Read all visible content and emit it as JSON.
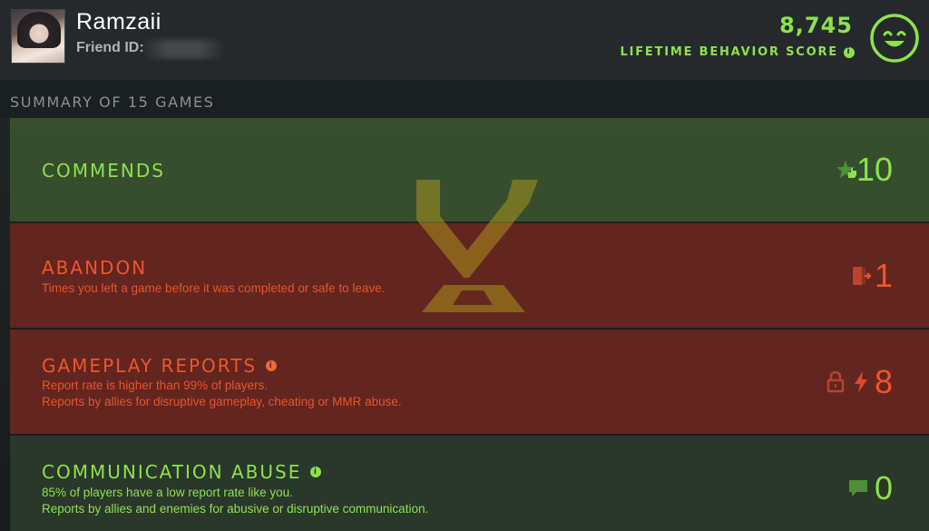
{
  "profile": {
    "name": "Ramzaii",
    "friend_id_label": "Friend ID:",
    "friend_id_value": ""
  },
  "behavior": {
    "score": "8,745",
    "label": "LIFETIME BEHAVIOR SCORE",
    "info_glyph": "i",
    "status_icon": "smiley-face-icon"
  },
  "summary": {
    "title": "SUMMARY OF 15 GAMES"
  },
  "rows": {
    "commends": {
      "title": "COMMENDS",
      "count": "10",
      "icon": "star-thumbs-up-icon"
    },
    "abandon": {
      "title": "ABANDON",
      "desc": "Times you left a game before it was completed or safe to leave.",
      "count": "1",
      "icon": "exit-door-icon"
    },
    "gameplay_reports": {
      "title": "GAMEPLAY REPORTS",
      "info_glyph": "i",
      "desc1": "Report rate is higher than 99% of players.",
      "desc2": "Reports by allies for disruptive gameplay, cheating or MMR abuse.",
      "count": "8",
      "icons": [
        "lock-icon",
        "lightning-icon"
      ]
    },
    "communication_abuse": {
      "title": "COMMUNICATION ABUSE",
      "info_glyph": "i",
      "desc1": "85% of players have a low report rate like you.",
      "desc2": "Reports by allies and enemies for abusive or disruptive communication.",
      "count": "0",
      "icon": "chat-bubble-icon"
    }
  },
  "colors": {
    "positive": "#8de24c",
    "negative": "#f0552a",
    "commends_bg": "#385230",
    "penalty_bg": "#682620",
    "header_bg": "#25292c"
  }
}
